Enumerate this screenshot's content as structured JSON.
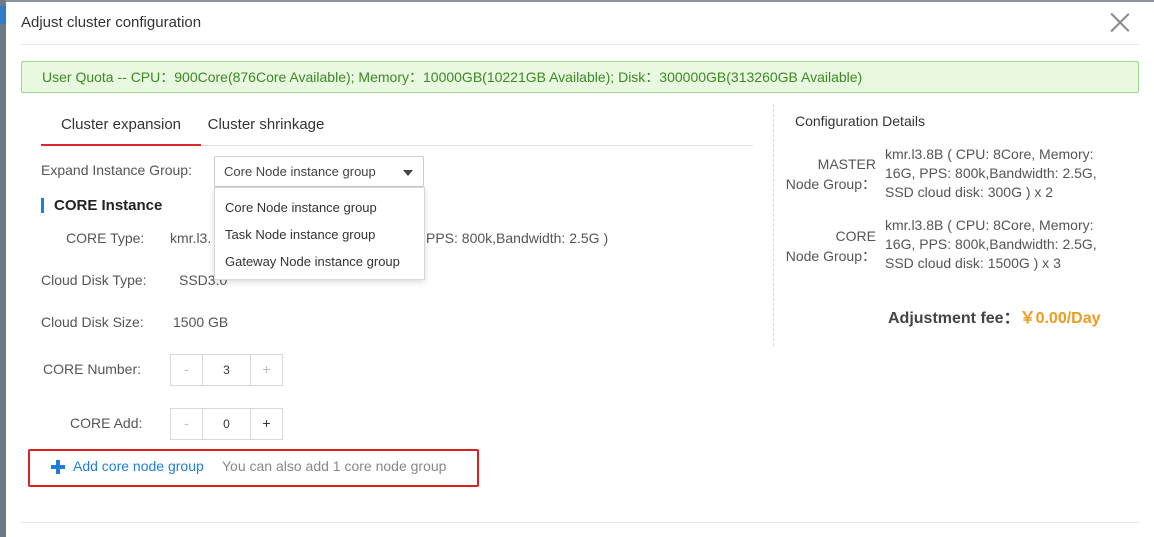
{
  "dialog": {
    "title": "Adjust cluster configuration"
  },
  "quota": {
    "text": "User Quota -- CPU：900Core(876Core Available); Memory：10000GB(10221GB Available); Disk：300000GB(313260GB Available)"
  },
  "tabs": [
    {
      "label": "Cluster expansion",
      "active": true
    },
    {
      "label": "Cluster shrinkage",
      "active": false
    }
  ],
  "form": {
    "expand_group_label": "Expand Instance Group:",
    "expand_group_selected": "Core Node instance group",
    "expand_group_options": [
      "Core Node instance group",
      "Task Node instance group",
      "Gateway Node instance group"
    ],
    "section_title": "CORE Instance",
    "core_type_label": "CORE Type:",
    "core_type_value_prefix": "kmr.l3.",
    "core_type_value_suffix": "PPS: 800k,Bandwidth: 2.5G )",
    "disk_type_label": "Cloud Disk Type:",
    "disk_type_value": "SSD3.0",
    "disk_size_label": "Cloud Disk Size:",
    "disk_size_value": "1500 GB",
    "core_number_label": "CORE Number:",
    "core_number": {
      "minus": "-",
      "value": "3",
      "plus": "+"
    },
    "core_add_label": "CORE Add:",
    "core_add": {
      "minus": "-",
      "value": "0",
      "plus": "+"
    },
    "add_link": "Add core node group",
    "add_hint": "You can also add 1 core node group"
  },
  "config": {
    "title": "Configuration Details",
    "groups": [
      {
        "label_line1": "MASTER",
        "label_line2": "Node Group：",
        "desc": "kmr.l3.8B ( CPU: 8Core, Memory: 16G, PPS: 800k,Bandwidth: 2.5G, SSD cloud disk: 300G ) x 2"
      },
      {
        "label_line1": "CORE",
        "label_line2": "Node Group：",
        "desc": "kmr.l3.8B ( CPU: 8Core, Memory: 16G, PPS: 800k,Bandwidth: 2.5G, SSD cloud disk: 1500G ) x 3"
      }
    ],
    "fee_label": "Adjustment fee：",
    "fee_value": "￥0.00/Day"
  },
  "colors": {
    "accent_blue": "#1e7fd9",
    "tab_active": "#d9272e",
    "fee_orange": "#f09a1e",
    "quota_text": "#3d8a22",
    "highlight_red": "#e02020"
  }
}
